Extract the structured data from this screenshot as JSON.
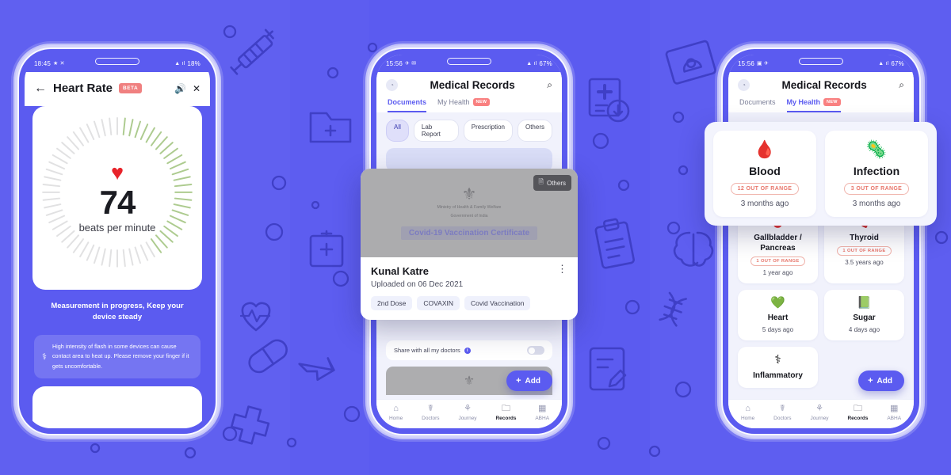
{
  "theme": {
    "background": "#5B5BF0",
    "accent": "#5B5BF0",
    "danger": "#F08080",
    "range_text": "#E8766B"
  },
  "phone1": {
    "statusbar": {
      "time": "18:45",
      "battery": "18%",
      "left_glyphs": "★ ✕",
      "right_glyphs": "▲ ıl"
    },
    "header": {
      "back_icon": "←",
      "title": "Heart Rate",
      "badge": "BETA",
      "speaker_icon": "🔊",
      "close_icon": "✕"
    },
    "gauge": {
      "heart_icon": "♥",
      "value": "74",
      "unit": "beats per minute"
    },
    "status_message": "Measurement in progress, Keep your device steady",
    "note": {
      "icon": "⚕",
      "text": "High intensity of flash in some devices can cause contact area to heat up. Please remove your finger if it gets uncomfortable."
    }
  },
  "phone2": {
    "statusbar": {
      "time": "15:56",
      "battery": "67%",
      "left_glyphs": "✈ ✉",
      "right_glyphs": "▲ ıl"
    },
    "header": {
      "avatar_icon": "◔",
      "title": "Medical Records",
      "search_icon": "⌕"
    },
    "tabs": [
      {
        "label": "Documents",
        "active": true,
        "badge": ""
      },
      {
        "label": "My Health",
        "active": false,
        "badge": "NEW"
      }
    ],
    "chips": [
      {
        "label": "All",
        "active": true
      },
      {
        "label": "Lab Report",
        "active": false
      },
      {
        "label": "Prescription",
        "active": false
      },
      {
        "label": "Others",
        "active": false
      }
    ],
    "share_row": {
      "label": "Share with all my doctors",
      "info_icon": "i",
      "toggle_on": false
    },
    "fab": {
      "plus": "+",
      "label": "Add"
    },
    "nav": [
      {
        "icon": "⌂",
        "label": "Home",
        "active": false
      },
      {
        "icon": "☤",
        "label": "Doctors",
        "active": false
      },
      {
        "icon": "⚘",
        "label": "Journey",
        "active": false
      },
      {
        "icon": "🗀",
        "label": "Records",
        "active": true
      },
      {
        "icon": "▦",
        "label": "ABHA",
        "active": false
      }
    ]
  },
  "doc_card": {
    "badge_icon": "🗎",
    "badge_label": "Others",
    "emblem_icon": "⚜",
    "ministry_line1": "Ministry of Health & Family Welfare",
    "ministry_line2": "Government of India",
    "certificate_title": "Covid-19 Vaccination Certificate",
    "name": "Kunal Katre",
    "kebab_icon": "⋮",
    "uploaded": "Uploaded on 06 Dec 2021",
    "tags": [
      "2nd Dose",
      "COVAXIN",
      "Covid Vaccination"
    ]
  },
  "phone3": {
    "statusbar": {
      "time": "15:56",
      "battery": "67%",
      "left_glyphs": "▣ ✈",
      "right_glyphs": "▲ ıl"
    },
    "header": {
      "avatar_icon": "◔",
      "title": "Medical Records",
      "search_icon": "⌕"
    },
    "tabs": [
      {
        "label": "Documents",
        "active": false,
        "badge": ""
      },
      {
        "label": "My Health",
        "active": true,
        "badge": "NEW"
      }
    ],
    "fab": {
      "plus": "+",
      "label": "Add"
    },
    "nav": [
      {
        "icon": "⌂",
        "label": "Home",
        "active": false
      },
      {
        "icon": "☤",
        "label": "Doctors",
        "active": false
      },
      {
        "icon": "⚘",
        "label": "Journey",
        "active": false
      },
      {
        "icon": "🗀",
        "label": "Records",
        "active": true
      },
      {
        "icon": "▦",
        "label": "ABHA",
        "active": false
      }
    ],
    "health_cards": [
      {
        "icon": "🩸",
        "name": "Gallbladder / Pancreas",
        "range": "1 OUT OF RANGE",
        "when": "1 year ago"
      },
      {
        "icon": "🫀",
        "name": "Thyroid",
        "range": "1 OUT OF RANGE",
        "when": "3.5 years ago"
      },
      {
        "icon": "💚",
        "name": "Heart",
        "range": "",
        "when": "5 days ago"
      },
      {
        "icon": "📗",
        "name": "Sugar",
        "range": "",
        "when": "4 days ago"
      },
      {
        "icon": "⚕",
        "name": "Inflammatory",
        "range": "",
        "when": ""
      }
    ]
  },
  "highlight_panel": {
    "cards": [
      {
        "icon": "🩸",
        "name": "Blood",
        "range": "12 OUT OF RANGE",
        "when": "3 months ago"
      },
      {
        "icon": "🦠",
        "name": "Infection",
        "range": "3 OUT OF RANGE",
        "when": "3 months ago"
      }
    ]
  }
}
